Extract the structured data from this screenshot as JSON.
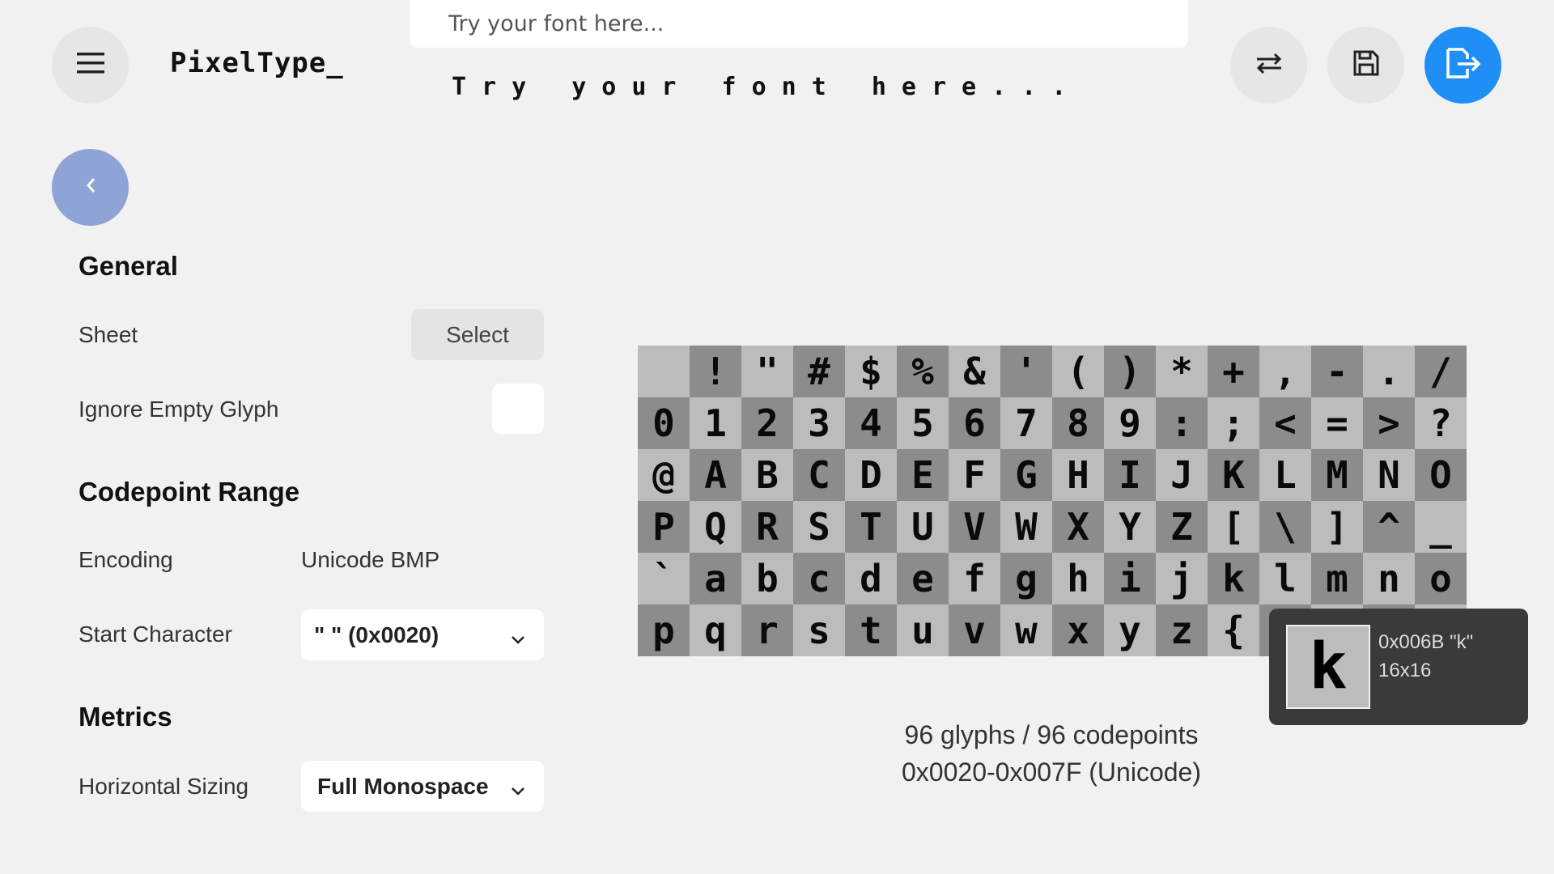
{
  "header": {
    "logo": "PixelType_",
    "search": {
      "placeholder": "Try your font here..."
    },
    "preview_text": "Try your font here..."
  },
  "colors": {
    "accent": "#1f8ff5",
    "back_button": "#8ea3d6"
  },
  "icons": {
    "menu": "hamburger-menu-icon",
    "swap": "swap-arrows-icon",
    "save": "save-icon",
    "export": "export-icon",
    "back": "chevron-left-icon"
  },
  "settings": {
    "general": {
      "title": "General",
      "sheet_label": "Sheet",
      "select_label": "Select",
      "ignore_empty_label": "Ignore Empty Glyph"
    },
    "codepoint": {
      "title": "Codepoint Range",
      "encoding_label": "Encoding",
      "encoding_value": "Unicode BMP",
      "start_label": "Start Character",
      "start_value": "\" \" (0x0020)"
    },
    "metrics": {
      "title": "Metrics",
      "hsizing_label": "Horizontal Sizing",
      "hsizing_value": "Full Monospace"
    }
  },
  "glyphs": [
    " ",
    "!",
    "\"",
    "#",
    "$",
    "%",
    "&",
    "'",
    "(",
    ")",
    "*",
    "+",
    ",",
    "-",
    ".",
    "/",
    "0",
    "1",
    "2",
    "3",
    "4",
    "5",
    "6",
    "7",
    "8",
    "9",
    ":",
    ";",
    "<",
    "=",
    ">",
    "?",
    "@",
    "A",
    "B",
    "C",
    "D",
    "E",
    "F",
    "G",
    "H",
    "I",
    "J",
    "K",
    "L",
    "M",
    "N",
    "O",
    "P",
    "Q",
    "R",
    "S",
    "T",
    "U",
    "V",
    "W",
    "X",
    "Y",
    "Z",
    "[",
    "\\",
    "]",
    "^",
    "_",
    "`",
    "a",
    "b",
    "c",
    "d",
    "e",
    "f",
    "g",
    "h",
    "i",
    "j",
    "k",
    "l",
    "m",
    "n",
    "o",
    "p",
    "q",
    "r",
    "s",
    "t",
    "u",
    "v",
    "w",
    "x",
    "y",
    "z",
    "{",
    "|",
    "}",
    "~",
    ""
  ],
  "stats": {
    "count": "96 glyphs / 96 codepoints",
    "range": "0x0020-0x007F (Unicode)"
  },
  "tooltip": {
    "glyph": "k",
    "code": "0x006B \"k\"",
    "size": "16x16"
  }
}
